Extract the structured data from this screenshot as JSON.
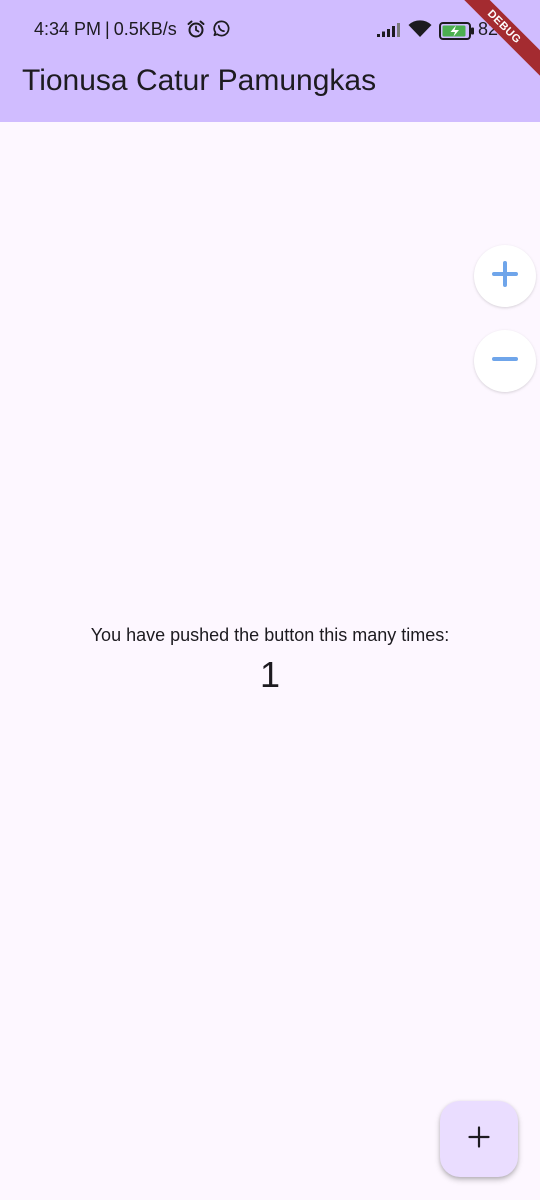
{
  "status_bar": {
    "time": "4:34 PM",
    "separator": "|",
    "network_speed": "0.5KB/s",
    "battery_percent": "82",
    "icons": [
      "alarm-icon",
      "whatsapp-icon",
      "signal-icon",
      "wifi-icon",
      "battery-charging-icon"
    ]
  },
  "debug_banner": {
    "label": "DEBUG",
    "color": "#a42b30"
  },
  "app_bar": {
    "title": "Tionusa Catur Pamungkas",
    "background": "#d0bcff"
  },
  "side_buttons": {
    "zoom_in_icon": "plus-icon",
    "zoom_out_icon": "minus-icon",
    "icon_color": "#6fa5ea"
  },
  "counter": {
    "label": "You have pushed the button this many times:",
    "value": "1"
  },
  "fab": {
    "icon": "plus-icon",
    "background": "#eaddff"
  },
  "theme": {
    "page_background": "#fdf7ff",
    "text_color": "#1d1b20"
  }
}
